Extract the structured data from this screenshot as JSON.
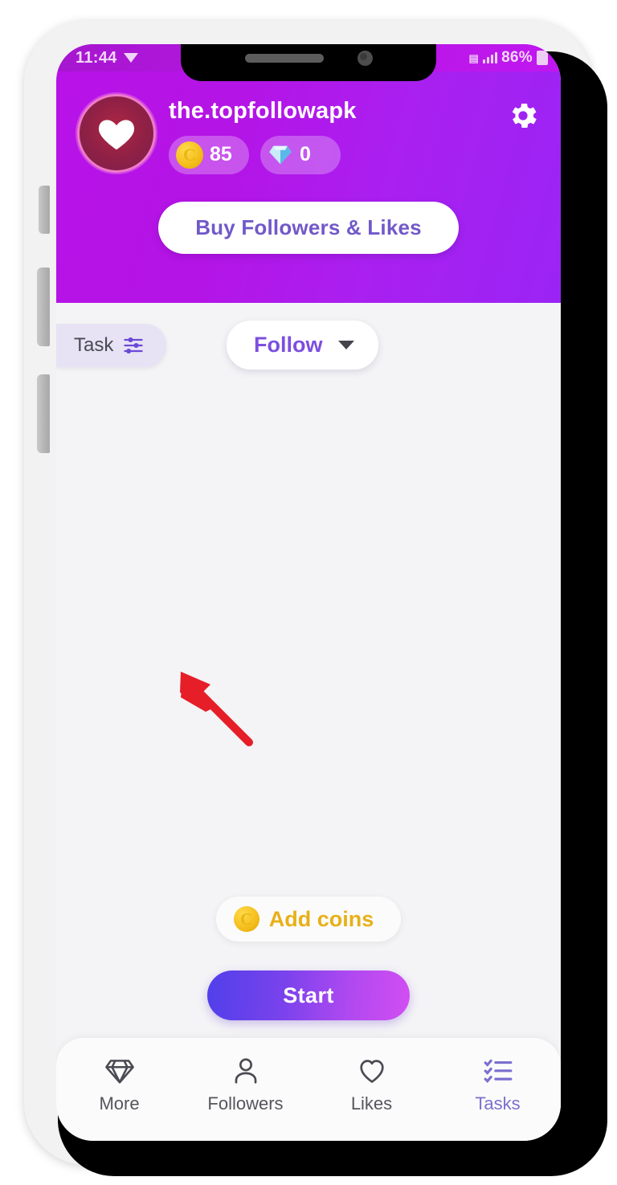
{
  "status_bar": {
    "time": "11:44",
    "battery_percent": "86%",
    "sim_icon": "sim-card-icon",
    "signal_icon": "signal-bars-icon",
    "battery_icon": "battery-icon",
    "dropdown_icon": "triangle-down-icon"
  },
  "header": {
    "username": "the.topfollowapk",
    "avatar_icon": "heart-avatar-icon",
    "settings_icon": "gear-icon",
    "coins": {
      "icon": "coin-icon",
      "value": "85"
    },
    "diamonds": {
      "icon": "diamond-icon",
      "value": "0"
    },
    "buy_button_label": "Buy Followers & Likes",
    "gradient_start": "#b812e8",
    "gradient_end": "#9a24f5"
  },
  "toolbar": {
    "task_tab_label": "Task",
    "task_tab_icon": "sliders-filter-icon",
    "follow_dropdown_label": "Follow",
    "follow_dropdown_icon": "chevron-down-icon",
    "accent_color": "#7c4fe0"
  },
  "annotation": {
    "arrow_icon": "red-arrow-icon",
    "arrow_color": "#e51e28",
    "points_at": "Task"
  },
  "actions": {
    "add_coins_label": "Add coins",
    "add_coins_icon": "coin-icon",
    "add_coins_color": "#e8b018",
    "start_label": "Start",
    "start_gradient_start": "#5040ea",
    "start_gradient_end": "#d24ef2"
  },
  "bottom_nav": {
    "active_color": "#7b6fd0",
    "items": [
      {
        "label": "More",
        "icon": "diamond-icon",
        "active": false
      },
      {
        "label": "Followers",
        "icon": "person-icon",
        "active": false
      },
      {
        "label": "Likes",
        "icon": "heart-icon",
        "active": false
      },
      {
        "label": "Tasks",
        "icon": "checklist-icon",
        "active": true
      }
    ]
  }
}
